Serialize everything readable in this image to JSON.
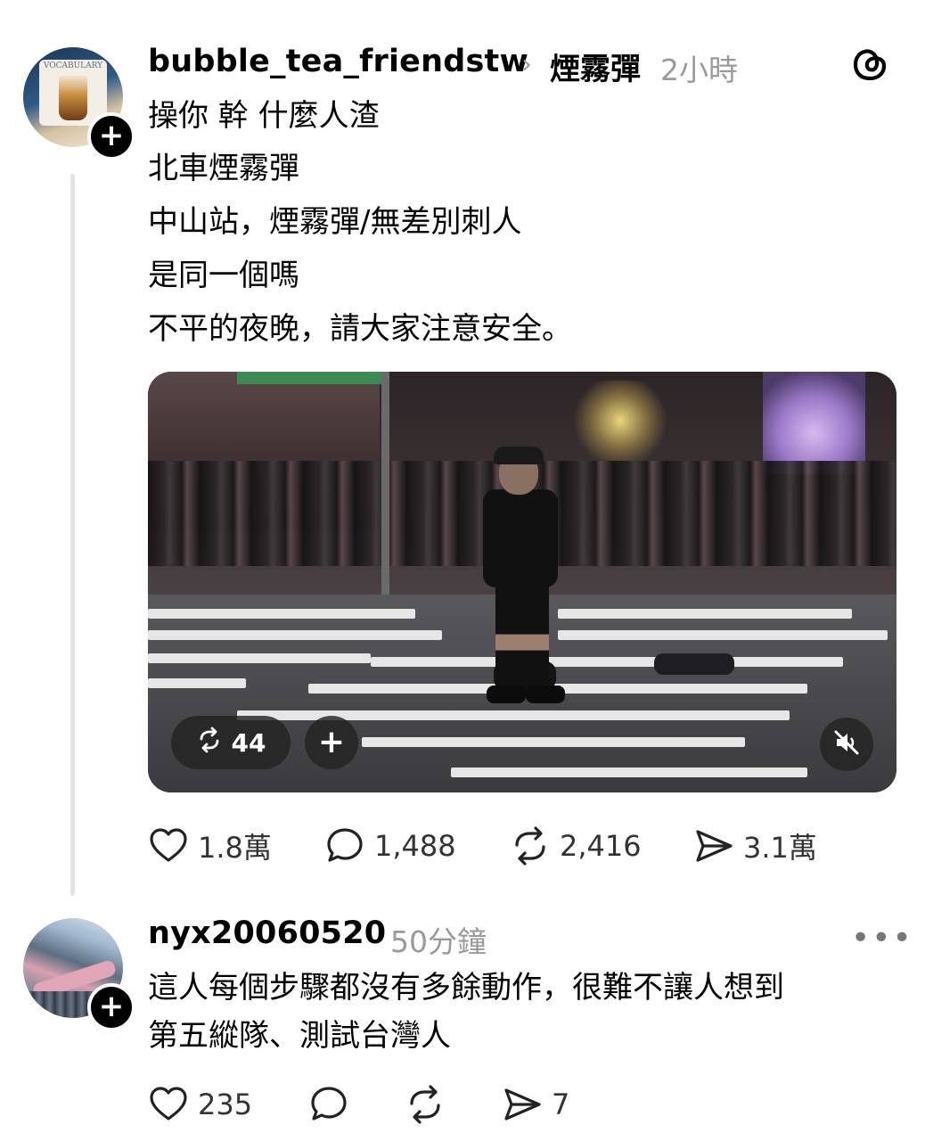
{
  "post": {
    "username": "bubble_tea_friendstw",
    "topic": "煙霧彈",
    "time": "2小時",
    "lines": [
      "操你 幹 什麼人渣",
      "北車煙霧彈",
      "中山站，煙霧彈/無差別刺人",
      "是同一個嗎",
      "不平的夜晚，請大家注意安全。"
    ],
    "video": {
      "repost_count": "44"
    },
    "stats": {
      "likes": "1.8萬",
      "comments": "1,488",
      "reposts": "2,416",
      "shares": "3.1萬"
    },
    "avatar_text": "VOCABULARY"
  },
  "reply": {
    "username": "nyx20060520",
    "time": "50分鐘",
    "lines": [
      "這人每個步驟都沒有多餘動作，很難不讓人想到",
      "第五縱隊、測試台灣人"
    ],
    "stats": {
      "likes": "235",
      "shares": "7"
    }
  },
  "icons": {
    "app_logo": "threads-logo-icon",
    "like": "heart-icon",
    "comment": "comment-bubble-icon",
    "repost": "repost-icon",
    "share": "send-icon",
    "mute": "muted-speaker-icon",
    "follow": "plus-icon",
    "more": "more-dots-icon"
  }
}
